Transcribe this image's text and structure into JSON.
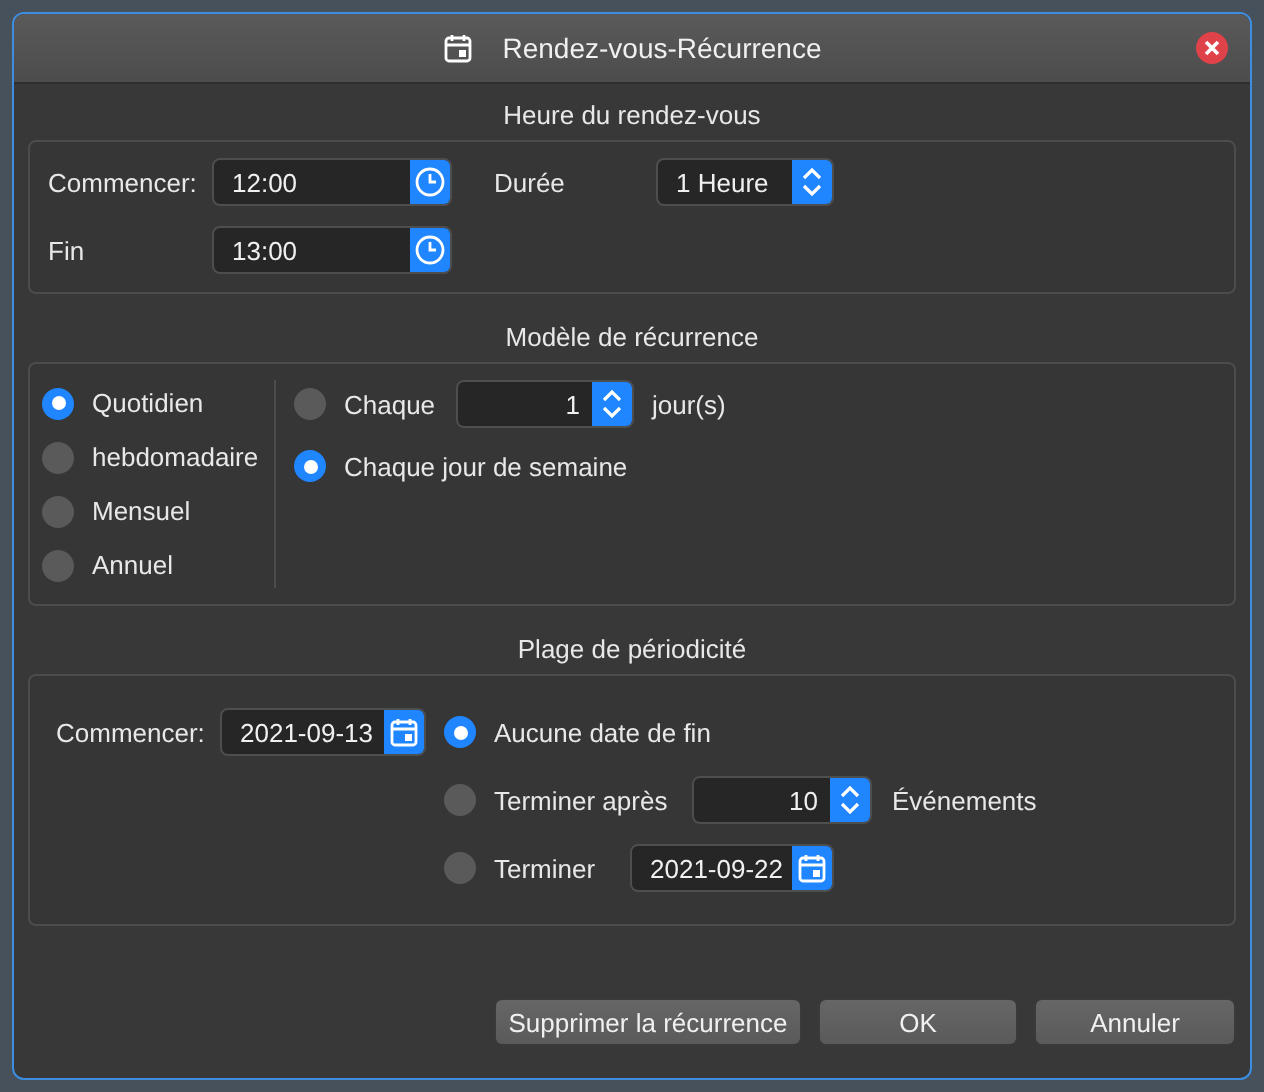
{
  "window": {
    "title": "Rendez-vous-Récurrence"
  },
  "appointment_time": {
    "heading": "Heure du rendez-vous",
    "start": {
      "label": "Commencer:",
      "value": "12:00"
    },
    "duration": {
      "label": "Durée",
      "value": "1 Heure"
    },
    "end": {
      "label": "Fin",
      "value": "13:00"
    }
  },
  "recurrence_pattern": {
    "heading": "Modèle de récurrence",
    "frequencies": [
      {
        "label": "Quotidien",
        "selected": true
      },
      {
        "label": "hebdomadaire",
        "selected": false
      },
      {
        "label": "Mensuel",
        "selected": false
      },
      {
        "label": "Annuel",
        "selected": false
      }
    ],
    "options": [
      {
        "kind": "interval",
        "label": "Chaque",
        "value": "1",
        "unit": "jour(s)",
        "selected": false
      },
      {
        "kind": "plain",
        "label": "Chaque jour de semaine",
        "selected": true
      }
    ]
  },
  "range": {
    "heading": "Plage de périodicité",
    "start": {
      "label": "Commencer:",
      "value": "2021-09-13"
    },
    "end_options": [
      {
        "kind": "none",
        "label": "Aucune date de fin",
        "selected": true
      },
      {
        "kind": "count",
        "label": "Terminer après",
        "value": "10",
        "unit": "Événements",
        "selected": false
      },
      {
        "kind": "date",
        "label": "Terminer",
        "value": "2021-09-22",
        "selected": false
      }
    ]
  },
  "buttons": [
    "Supprimer la récurrence",
    "OK",
    "Annuler"
  ]
}
